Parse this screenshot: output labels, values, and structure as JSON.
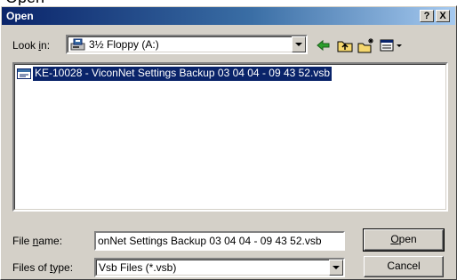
{
  "title": "Open",
  "titlebar_buttons": {
    "help": "?",
    "close": "X"
  },
  "look_in": {
    "label_pre": "Look ",
    "label_key": "i",
    "label_post": "n:",
    "value": "3½ Floppy (A:)",
    "icon": "floppy-drive-icon"
  },
  "toolbar": {
    "icons": [
      "back-arrow-icon",
      "up-folder-icon",
      "new-folder-icon",
      "view-menu-icon"
    ]
  },
  "files": [
    {
      "name": "KE-10028 - ViconNet Settings Backup 03 04 04 - 09 43 52.vsb",
      "icon": "vsb-file-icon",
      "selected": true
    }
  ],
  "file_name": {
    "label_pre": "File ",
    "label_key": "n",
    "label_post": "ame:",
    "value": "onNet Settings Backup 03 04 04 - 09 43 52.vsb"
  },
  "files_of_type": {
    "label_pre": "Files of ",
    "label_key": "t",
    "label_post": "ype:",
    "value": "Vsb Files (*.vsb)"
  },
  "buttons": {
    "open": "Open",
    "open_key": "O",
    "open_rest": "pen",
    "cancel": "Cancel"
  },
  "colors": {
    "titlebar_start": "#0a246a",
    "titlebar_end": "#a6caf0",
    "selection": "#0a246a",
    "face": "#d4d0c8"
  }
}
